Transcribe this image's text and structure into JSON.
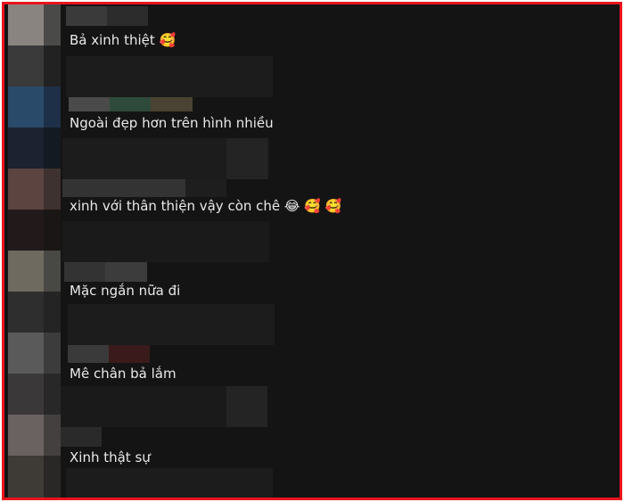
{
  "comments": [
    {
      "text": "Bả xinh thiệt",
      "emoji": "🥰"
    },
    {
      "text": "Ngoài đẹp hơn trên hình nhiều",
      "emoji": ""
    },
    {
      "text": "xinh với thân thiện vậy còn chê",
      "emoji": "😂 🥰 🥰"
    },
    {
      "text": "Mặc ngắn nữa đi",
      "emoji": ""
    },
    {
      "text": "Mê chân bả lắm",
      "emoji": ""
    },
    {
      "text": "Xinh thật sự",
      "emoji": ""
    }
  ],
  "colors": {
    "border": "#e8141c",
    "background": "#141414",
    "text": "#e9e9e9"
  }
}
